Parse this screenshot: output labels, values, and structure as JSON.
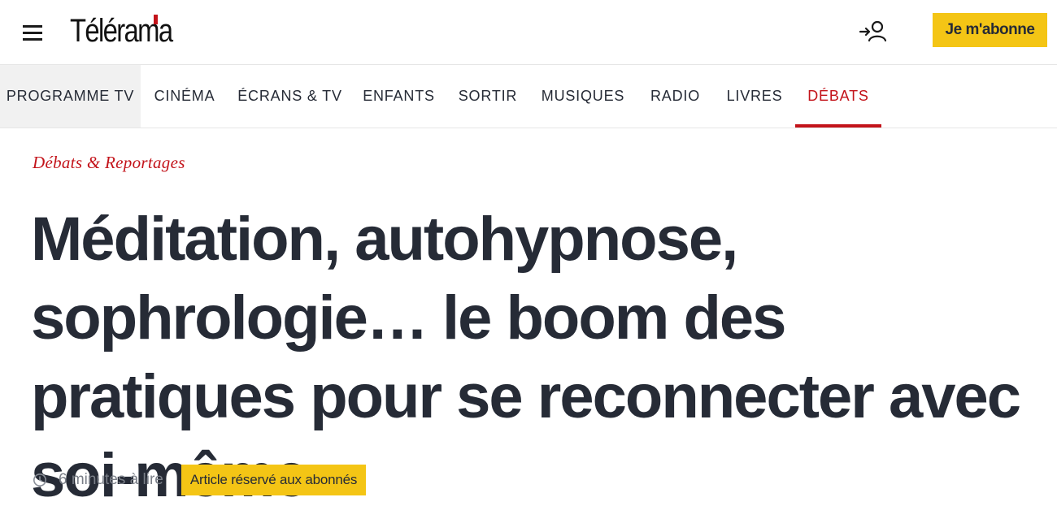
{
  "header": {
    "logo_text": "Télérama",
    "subscribe_label": "Je m'abonne"
  },
  "nav": {
    "items": [
      {
        "label": "PROGRAMME TV"
      },
      {
        "label": "CINÉMA"
      },
      {
        "label": "ÉCRANS & TV"
      },
      {
        "label": "ENFANTS"
      },
      {
        "label": "SORTIR"
      },
      {
        "label": "MUSIQUES"
      },
      {
        "label": "RADIO"
      },
      {
        "label": "LIVRES"
      },
      {
        "label": "DÉBATS"
      }
    ],
    "active": "DÉBATS"
  },
  "article": {
    "kicker": "Débats & Reportages",
    "headline": "Méditation, autohypnose, sophrologie… le boom des pratiques pour se reconnecter avec soi-même",
    "read_time": "6 minutes à lire",
    "badge": "Article réservé aux abonnés"
  },
  "colors": {
    "accent_red": "#c3131a",
    "subscribe_yellow": "#f4c515",
    "text_dark": "#262b36"
  },
  "icons": [
    "menu-icon",
    "login-user-icon",
    "clock-icon"
  ]
}
